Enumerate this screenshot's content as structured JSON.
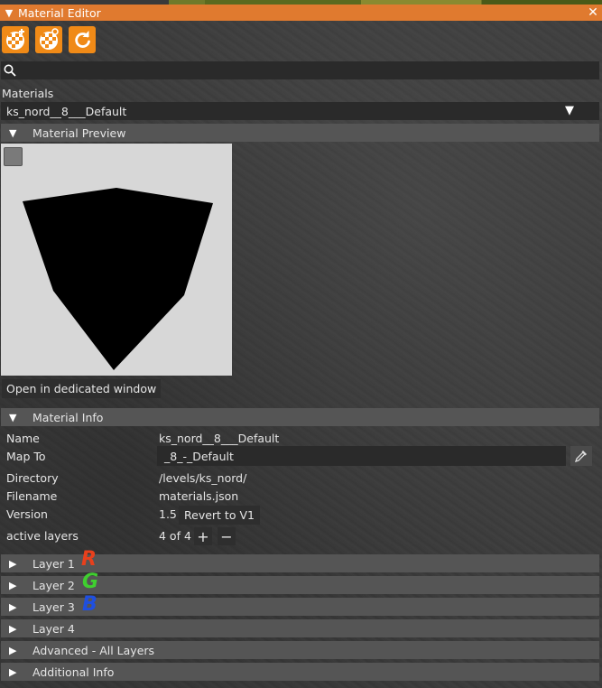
{
  "window": {
    "title": "Material Editor",
    "close_glyph": "✕",
    "collapse_glyph": "▼"
  },
  "toolbar": {
    "buttons": [
      {
        "icon": "add-material-icon"
      },
      {
        "icon": "clone-material-icon"
      },
      {
        "icon": "refresh-icon"
      }
    ],
    "accent": "#f08a17"
  },
  "search": {
    "value": "",
    "placeholder": ""
  },
  "materials": {
    "label": "Materials",
    "selected": "ks_nord__8___Default"
  },
  "preview": {
    "section_title": "Material Preview",
    "open_button": "Open in dedicated window"
  },
  "info": {
    "section_title": "Material Info",
    "name_label": "Name",
    "name_value": "ks_nord__8___Default",
    "mapto_label": "Map To",
    "mapto_value": "_8_-_Default",
    "directory_label": "Directory",
    "directory_value": "/levels/ks_nord/",
    "filename_label": "Filename",
    "filename_value": "materials.json",
    "version_label": "Version",
    "version_value": "1.5",
    "revert_button": "Revert to V1",
    "layers_label": "active layers",
    "layers_value": "4 of 4",
    "plus": "+",
    "minus": "−"
  },
  "sections": [
    {
      "title": "Layer 1",
      "annotation": "R",
      "annotation_color": "#e8401c"
    },
    {
      "title": "Layer 2",
      "annotation": "G",
      "annotation_color": "#3fcf2f"
    },
    {
      "title": "Layer 3",
      "annotation": "B",
      "annotation_color": "#1f4fe0"
    },
    {
      "title": "Layer 4"
    },
    {
      "title": "Advanced - All Layers"
    },
    {
      "title": "Additional Info"
    }
  ],
  "colors": {
    "titlebar": "#e07a2f",
    "section_header": "#555555",
    "field_bg": "#2a2a2a"
  }
}
